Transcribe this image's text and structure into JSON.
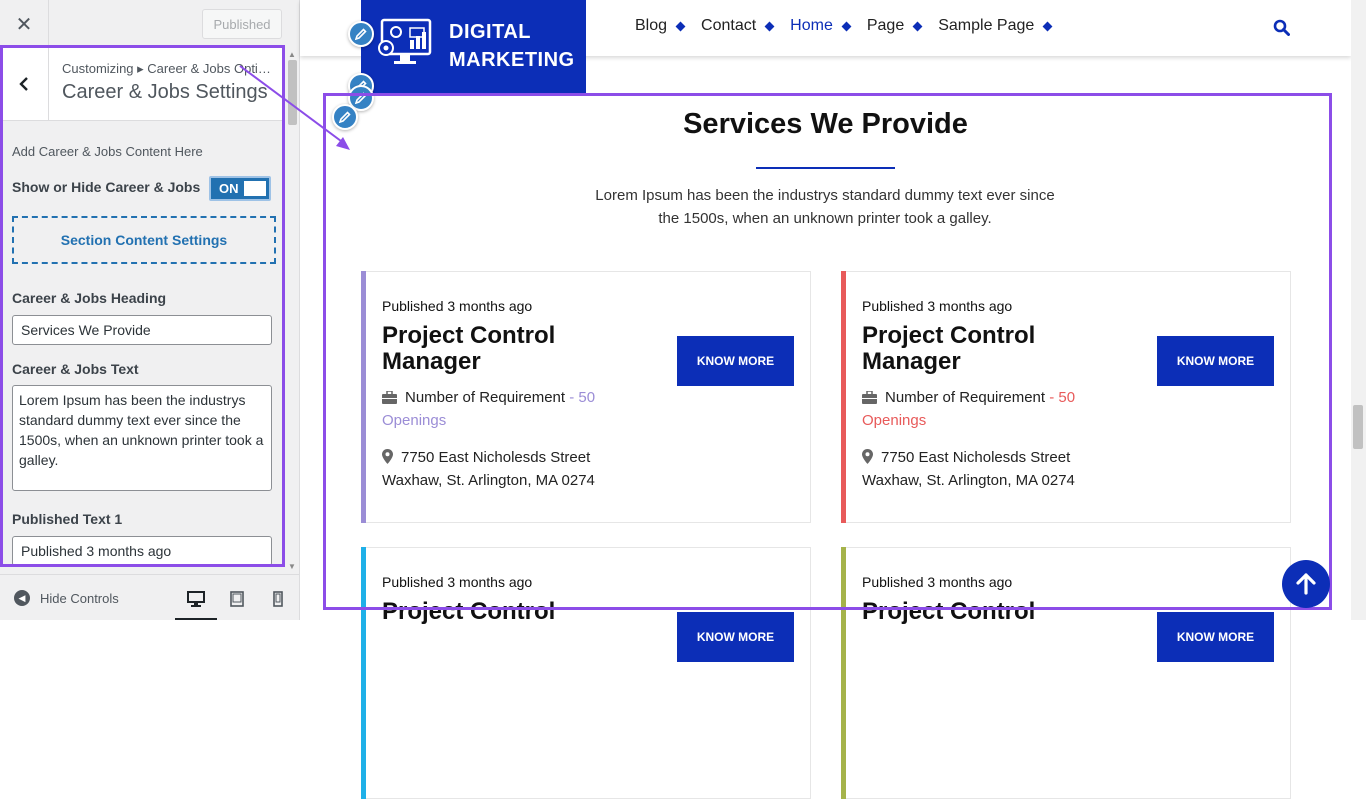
{
  "customizer": {
    "close_symbol": "✕",
    "published_label": "Published",
    "breadcrumb": "Customizing ▸ Career & Jobs Opti…",
    "section_title": "Career & Jobs Settings",
    "description": "Add Career & Jobs Content Here",
    "toggle_label": "Show or Hide Career & Jobs",
    "toggle_state": "ON",
    "section_button": "Section Content Settings",
    "heading_label": "Career & Jobs Heading",
    "heading_value": "Services We Provide",
    "text_label": "Career & Jobs Text",
    "text_value": "Lorem Ipsum has been the industrys standard dummy text ever since the 1500s, when an unknown printer took a galley.",
    "published_text_label": "Published Text 1",
    "published_text_value": "Published 3 months ago",
    "footer": {
      "hide_controls": "Hide Controls",
      "devices": [
        "desktop-icon",
        "tablet-icon",
        "mobile-icon"
      ]
    }
  },
  "site": {
    "logo_line1": "DIGITAL",
    "logo_line2": "MARKETING",
    "nav": [
      {
        "label": "Blog",
        "active": false
      },
      {
        "label": "Contact",
        "active": false
      },
      {
        "label": "Home",
        "active": true
      },
      {
        "label": "Page",
        "active": false
      },
      {
        "label": "Sample Page",
        "active": false
      }
    ],
    "section": {
      "title": "Services We Provide",
      "text": "Lorem Ipsum has been the industrys standard dummy text ever since the 1500s, when an unknown printer took a galley."
    },
    "cards": [
      {
        "published": "Published 3 months ago",
        "title": "Project Control Manager",
        "button": "KNOW MORE",
        "req_label": "Number of Requirement",
        "req_value": "- 50 Openings",
        "address": "7750 East Nicholesds Street Waxhaw, St. Arlington, MA 0274",
        "accent": "#9b8dd6"
      },
      {
        "published": "Published 3 months ago",
        "title": "Project Control Manager",
        "button": "KNOW MORE",
        "req_label": "Number of Requirement",
        "req_value": "- 50 Openings",
        "address": "7750 East Nicholesds Street Waxhaw, St. Arlington, MA 0274",
        "accent": "#e85a5a"
      },
      {
        "published": "Published 3 months ago",
        "title": "Project Control",
        "button": "KNOW MORE",
        "accent": "#1fb0e8"
      },
      {
        "published": "Published 3 months ago",
        "title": "Project Control",
        "button": "KNOW MORE",
        "accent": "#a5b34a"
      }
    ]
  },
  "colors": {
    "brand_blue": "#0c2eb7",
    "highlight_purple": "#8c4de8",
    "wp_blue": "#2271b1"
  }
}
